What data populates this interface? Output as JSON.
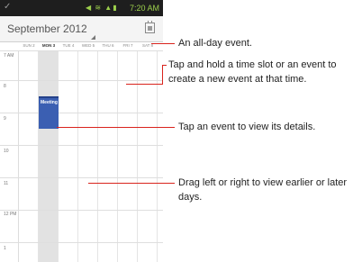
{
  "status_bar": {
    "time": "7:20 AM"
  },
  "header": {
    "title": "September 2012"
  },
  "days": [
    {
      "label": "SUN 2",
      "today": false
    },
    {
      "label": "MON 3",
      "today": true
    },
    {
      "label": "TUE 4",
      "today": false
    },
    {
      "label": "WED 5",
      "today": false
    },
    {
      "label": "THU 6",
      "today": false
    },
    {
      "label": "FRI 7",
      "today": false
    },
    {
      "label": "SAT 8",
      "today": false
    }
  ],
  "hours": [
    "7 AM",
    "8",
    "9",
    "10",
    "11",
    "12 PM",
    "1"
  ],
  "event": {
    "title": "Meeting"
  },
  "annotations": {
    "all_day": "An all-day event.",
    "tap_hold": "Tap and hold a time slot or an event to create a new event at that time.",
    "tap_event": "Tap an event to view its details.",
    "drag": "Drag left or right to view earlier or later days."
  },
  "colors": {
    "event": "#3b5fb2",
    "leader": "#d9231d",
    "status_accent": "#9ccf4c"
  }
}
